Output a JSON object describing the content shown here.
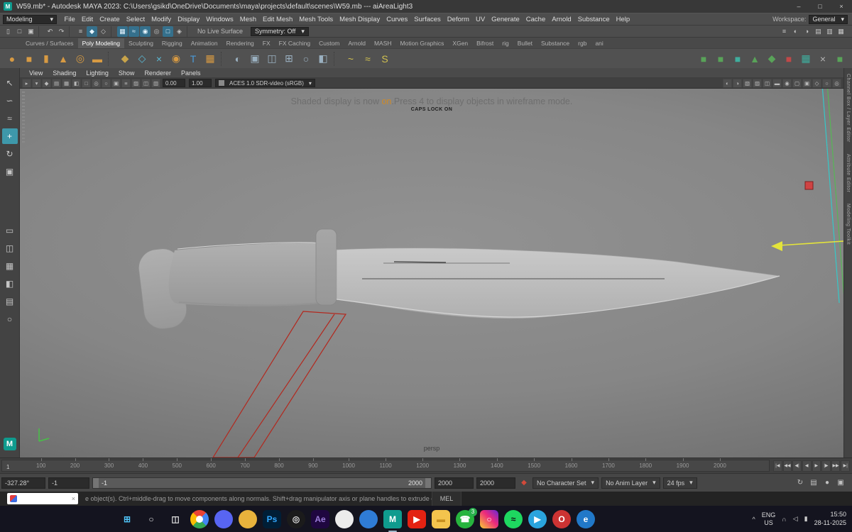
{
  "ui": {
    "chevron_down": "▾",
    "close_x": "×"
  },
  "titlebar": {
    "title": "W59.mb* - Autodesk MAYA 2023: C:\\Users\\gsikd\\OneDrive\\Documents\\maya\\projects\\default\\scenes\\W59.mb   ---   aiAreaLight3",
    "app_glyph": "M",
    "minimize": "–",
    "maximize": "□",
    "close": "×"
  },
  "menubar": {
    "mode": "Modeling",
    "items": [
      "File",
      "Edit",
      "Create",
      "Select",
      "Modify",
      "Display",
      "Windows",
      "Mesh",
      "Edit Mesh",
      "Mesh Tools",
      "Mesh Display",
      "Curves",
      "Surfaces",
      "Deform",
      "UV",
      "Generate",
      "Cache",
      "Arnold",
      "Substance",
      "Help"
    ],
    "workspace_label": "Workspace:",
    "workspace_value": "General"
  },
  "statusline": {
    "icons_left": [
      {
        "n": "new-scene-icon",
        "g": "▯"
      },
      {
        "n": "open-scene-icon",
        "g": "□"
      },
      {
        "n": "save-scene-icon",
        "g": "▣"
      },
      {
        "n": "separator",
        "cls": "sep"
      },
      {
        "n": "undo-icon",
        "g": "↶"
      },
      {
        "n": "redo-icon",
        "g": "↷"
      },
      {
        "n": "separator",
        "cls": "sep"
      },
      {
        "n": "select-hierarchy-icon",
        "g": "≡"
      },
      {
        "n": "select-object-icon",
        "g": "◆",
        "cls": "on"
      },
      {
        "n": "select-component-icon",
        "g": "◇"
      },
      {
        "n": "separator",
        "cls": "sep"
      },
      {
        "n": "snap-grid-icon",
        "g": "▦",
        "cls": "on"
      },
      {
        "n": "snap-curve-icon",
        "g": "≈",
        "cls": "on"
      },
      {
        "n": "snap-point-icon",
        "g": "◉",
        "cls": "on"
      },
      {
        "n": "snap-center-icon",
        "g": "◎"
      },
      {
        "n": "snap-plane-icon",
        "g": "□",
        "cls": "on"
      },
      {
        "n": "make-live-icon",
        "g": "◈"
      },
      {
        "n": "separator",
        "cls": "sep"
      }
    ],
    "live_surface": "No Live Surface",
    "symmetry": "Symmetry: Off",
    "icons_right": [
      {
        "n": "construction-history-icon",
        "g": "≡"
      },
      {
        "n": "render-icon",
        "g": "◐"
      },
      {
        "n": "ipr-render-icon",
        "g": "◑"
      },
      {
        "n": "render-settings-icon",
        "g": "▤"
      },
      {
        "n": "display-layers-icon",
        "g": "▥"
      },
      {
        "n": "grid-toggle-icon",
        "g": "▦"
      }
    ]
  },
  "shelf": {
    "tabs": [
      {
        "label": "Curves / Surfaces"
      },
      {
        "label": "Poly Modeling",
        "cls": "active"
      },
      {
        "label": "Sculpting"
      },
      {
        "label": "Rigging"
      },
      {
        "label": "Animation"
      },
      {
        "label": "Rendering"
      },
      {
        "label": "FX"
      },
      {
        "label": "FX Caching"
      },
      {
        "label": "Custom"
      },
      {
        "label": "Arnold"
      },
      {
        "label": "MASH"
      },
      {
        "label": "Motion Graphics"
      },
      {
        "label": "XGen"
      },
      {
        "label": "Bifrost"
      },
      {
        "label": "rig"
      },
      {
        "label": "Bullet"
      },
      {
        "label": "Substance"
      },
      {
        "label": "rgb"
      },
      {
        "label": "ani"
      }
    ],
    "icons": [
      {
        "n": "poly-sphere-icon",
        "g": "●",
        "c": "#d79a43"
      },
      {
        "n": "poly-cube-icon",
        "g": "■",
        "c": "#d79a43"
      },
      {
        "n": "poly-cylinder-icon",
        "g": "▮",
        "c": "#d79a43"
      },
      {
        "n": "poly-cone-icon",
        "g": "▲",
        "c": "#d79a43"
      },
      {
        "n": "poly-torus-icon",
        "g": "◎",
        "c": "#d79a43"
      },
      {
        "n": "poly-plane-icon",
        "g": "▬",
        "c": "#d79a43"
      },
      {
        "n": "separator",
        "cls": "shsep"
      },
      {
        "n": "sculpt-tool-icon",
        "g": "◆",
        "c": "#c8a44a"
      },
      {
        "n": "quad-draw-icon",
        "g": "◇",
        "c": "#5bb8d4"
      },
      {
        "n": "multi-cut-icon",
        "g": "×",
        "c": "#5bb8d4"
      },
      {
        "n": "target-weld-icon",
        "g": "◉",
        "c": "#d79a43"
      },
      {
        "n": "type-tool-icon",
        "g": "T",
        "c": "#4a9ad9"
      },
      {
        "n": "svg-tool-icon",
        "g": "▦",
        "c": "#d79a43"
      },
      {
        "n": "separator",
        "cls": "shsep"
      },
      {
        "n": "boolean-icon",
        "g": "◐",
        "c": "#9ab0c0"
      },
      {
        "n": "bevel-icon",
        "g": "▣",
        "c": "#9ab0c0"
      },
      {
        "n": "bridge-icon",
        "g": "◫",
        "c": "#9ab0c0"
      },
      {
        "n": "extrude-icon",
        "g": "⊞",
        "c": "#9ab0c0"
      },
      {
        "n": "smooth-icon",
        "g": "○",
        "c": "#9ab0c0"
      },
      {
        "n": "mirror-icon",
        "g": "◧",
        "c": "#9ab0c0"
      },
      {
        "n": "separator",
        "cls": "shsep"
      },
      {
        "n": "cv-curve-icon",
        "g": "~",
        "c": "#d0c050"
      },
      {
        "n": "ep-curve-icon",
        "g": "≈",
        "c": "#d0c050"
      },
      {
        "n": "arc-tool-icon",
        "g": "S",
        "c": "#d0c050"
      },
      {
        "n": "spacer",
        "cls": "shspacer"
      },
      {
        "n": "custom-cube-green-icon",
        "g": "■",
        "c": "#59a359"
      },
      {
        "n": "custom-cube-green2-icon",
        "g": "■",
        "c": "#59a359"
      },
      {
        "n": "custom-cube-teal-icon",
        "g": "■",
        "c": "#3fae9e"
      },
      {
        "n": "custom-cone-green-icon",
        "g": "▲",
        "c": "#59a359"
      },
      {
        "n": "custom-diamond-green-icon",
        "g": "◆",
        "c": "#59a359"
      },
      {
        "n": "custom-cube-red-icon",
        "g": "■",
        "c": "#c04848"
      },
      {
        "n": "custom-grid-teal-icon",
        "g": "▦",
        "c": "#3fae9e"
      },
      {
        "n": "custom-delete-icon",
        "g": "×",
        "c": "#b5b5b5"
      },
      {
        "n": "custom-cube-green3-icon",
        "g": "■",
        "c": "#59a359"
      }
    ]
  },
  "toolbox": {
    "tools": [
      {
        "n": "select-tool",
        "g": "↖"
      },
      {
        "n": "lasso-tool",
        "g": "∽"
      },
      {
        "n": "paint-select-tool",
        "g": "≈"
      },
      {
        "n": "move-tool",
        "g": "+",
        "cls": "sel"
      },
      {
        "n": "rotate-tool",
        "g": "↻"
      },
      {
        "n": "scale-tool",
        "g": "▣"
      }
    ],
    "layouts": [
      {
        "n": "single-pane-layout-icon",
        "g": "▭"
      },
      {
        "n": "two-pane-layout-icon",
        "g": "◫"
      },
      {
        "n": "four-pane-layout-icon",
        "g": "▦"
      },
      {
        "n": "outliner-layout-icon",
        "g": "◧"
      },
      {
        "n": "hypergraph-layout-icon",
        "g": "▤"
      },
      {
        "n": "zoom-tool-icon",
        "g": "○"
      }
    ],
    "m_label": "M"
  },
  "panel": {
    "menus": [
      "View",
      "Shading",
      "Lighting",
      "Show",
      "Renderer",
      "Panels"
    ],
    "icons_left": [
      {
        "n": "select-camera-icon",
        "g": "▸"
      },
      {
        "n": "lock-camera-icon",
        "g": "▾"
      },
      {
        "n": "camera-attributes-icon",
        "g": "◆"
      },
      {
        "n": "bookmarks-icon",
        "g": "▤"
      },
      {
        "n": "image-plane-icon",
        "g": "▦"
      },
      {
        "n": "2d-pan-zoom-icon",
        "g": "◧"
      },
      {
        "n": "grease-pencil-icon",
        "g": "□"
      },
      {
        "n": "grid-icon",
        "g": "◎"
      },
      {
        "n": "film-gate-icon",
        "g": "○"
      },
      {
        "n": "resolution-gate-icon",
        "g": "▣"
      },
      {
        "n": "gate-mask-icon",
        "g": "≡"
      },
      {
        "n": "field-chart-icon",
        "g": "▨"
      },
      {
        "n": "safe-action-icon",
        "g": "◫"
      },
      {
        "n": "safe-title-icon",
        "g": "▥"
      }
    ],
    "exposure": "0.00",
    "gamma": "1.00",
    "colorspace": "ACES 1.0 SDR-video (sRGB)",
    "icons_right": [
      {
        "n": "lighting-icon",
        "g": "◐"
      },
      {
        "n": "shadows-icon",
        "g": "◑"
      },
      {
        "n": "ambient-occlusion-icon",
        "g": "▧"
      },
      {
        "n": "anti-aliasing-icon",
        "g": "▨"
      },
      {
        "n": "xray-icon",
        "g": "◫"
      },
      {
        "n": "wireframe-on-shaded-icon",
        "g": "▬"
      },
      {
        "n": "textured-icon",
        "g": "◉"
      },
      {
        "n": "use-default-material-icon",
        "g": "▢"
      },
      {
        "n": "isolate-select-icon",
        "g": "▣"
      },
      {
        "n": "plugin-shapes-icon",
        "g": "◇"
      },
      {
        "n": "exposure-icon",
        "g": "○"
      },
      {
        "n": "gamma-icon",
        "g": "◎"
      }
    ]
  },
  "viewport": {
    "message_pre": "Shaded display is now ",
    "message_highlight": "on",
    "message_post": ".Press 4 to display objects in wireframe mode.",
    "caps_lock": "CAPS LOCK ON",
    "camera_label": "persp",
    "colors": {
      "knife_light": "#c9c9c9",
      "knife_mid": "#b0b0b0",
      "knife_dark": "#989898",
      "guard": "#a6a6a6",
      "wireframe": "#b3281e",
      "manip_yellow": "#e4e43a",
      "manip_cyan": "#35c8c8",
      "manip_green": "#56b656",
      "light_red": "#cf4343",
      "axis_green": "#46c246"
    }
  },
  "sidebar_right": {
    "tabs": [
      "Channel Box / Layer Editor",
      "Attribute Editor",
      "Modeling Toolkit"
    ]
  },
  "timeline": {
    "ticks": [
      "100",
      "200",
      "300",
      "400",
      "500",
      "600",
      "700",
      "800",
      "900",
      "1000",
      "1100",
      "1200",
      "1300",
      "1400",
      "1500",
      "1600",
      "1700",
      "1800",
      "1900",
      "2000"
    ],
    "current": "1",
    "controls": [
      {
        "n": "go-to-start-button",
        "g": "|◀"
      },
      {
        "n": "step-back-frame-button",
        "g": "◀◀"
      },
      {
        "n": "step-back-key-button",
        "g": "◀|"
      },
      {
        "n": "play-backwards-button",
        "g": "◀"
      },
      {
        "n": "play-forwards-button",
        "g": "▶"
      },
      {
        "n": "step-forward-key-button",
        "g": "|▶"
      },
      {
        "n": "step-forward-frame-button",
        "g": "▶▶"
      },
      {
        "n": "go-to-end-button",
        "g": "▶|"
      }
    ]
  },
  "range": {
    "value_readout": "-327.28°",
    "start": "-1",
    "range_start": "-1",
    "range_end": "2000",
    "end": "2000",
    "end2": "2000",
    "set_key_glyph": "◆",
    "character_set": "No Character Set",
    "anim_layer": "No Anim Layer",
    "fps": "24 fps",
    "icons": [
      {
        "n": "loop-icon",
        "g": "↻"
      },
      {
        "n": "anim-settings-icon",
        "g": "▤"
      },
      {
        "n": "auto-key-icon",
        "g": "●",
        "cls": "red"
      },
      {
        "n": "anim-prefs-icon",
        "g": "▣"
      }
    ]
  },
  "commandline": {
    "input_value": "",
    "mel_label": "MEL",
    "help_text": "e object(s). Ctrl+middle-drag to move components along normals. Shift+drag manipulator axis or plane handles to extrude components or clone objects. Ctrl+Shift+drag to con"
  },
  "taskbar": {
    "icons": [
      {
        "n": "start-button",
        "g": "⊞",
        "fg": "#4fc3f7"
      },
      {
        "n": "taskbar-search-icon",
        "g": "○",
        "fg": "#e0e0e0"
      },
      {
        "n": "task-view-icon",
        "g": "◫",
        "fg": "#e0e0e0"
      },
      {
        "n": "chrome-icon",
        "g": "",
        "cls": "chrome round"
      },
      {
        "n": "discord-icon",
        "g": "",
        "bg": "#5865f2",
        "cls": "round"
      },
      {
        "n": "honey-icon",
        "g": "",
        "bg": "#e8b23c",
        "cls": "round"
      },
      {
        "n": "photoshop-icon",
        "g": "Ps",
        "bg": "#001e36",
        "fg": "#31a8ff",
        "cls": "sq"
      },
      {
        "n": "obs-icon",
        "g": "◎",
        "bg": "#1b1b1b",
        "fg": "#dddddd",
        "cls": "round"
      },
      {
        "n": "after-effects-icon",
        "g": "Ae",
        "bg": "#1f0740",
        "fg": "#9a7cd8",
        "cls": "sq"
      },
      {
        "n": "chatgpt-icon",
        "g": "",
        "bg": "#ececec",
        "cls": "round"
      },
      {
        "n": "vscode-icon",
        "g": "",
        "bg": "#2f7cd6",
        "cls": "round"
      },
      {
        "n": "maya-icon",
        "g": "M",
        "bg": "#0f9b8e",
        "fg": "#ffffff",
        "cls": "sq active"
      },
      {
        "n": "youtube-icon",
        "g": "▶",
        "bg": "#e32212",
        "fg": "#ffffff",
        "cls": "sq"
      },
      {
        "n": "file-explorer-icon",
        "g": "▬",
        "bg": "#f3c44d",
        "fg": "#c8901f",
        "cls": "sq"
      },
      {
        "n": "whatsapp-icon",
        "g": "☎",
        "bg": "#27b43e",
        "fg": "#ffffff",
        "cls": "round",
        "badge": "3"
      },
      {
        "n": "instagram-icon",
        "g": "○",
        "fg": "#ffffff",
        "cls": "insta sq"
      },
      {
        "n": "spotify-icon",
        "g": "≈",
        "bg": "#1ed760",
        "fg": "#111111",
        "cls": "round"
      },
      {
        "n": "telegram-icon",
        "g": "▶",
        "bg": "#2aa4dd",
        "fg": "#ffffff",
        "cls": "round"
      },
      {
        "n": "opera-icon",
        "g": "O",
        "bg": "#cc3333",
        "fg": "#ffffff",
        "cls": "round"
      },
      {
        "n": "edge-icon",
        "g": "e",
        "bg": "#2178c8",
        "fg": "#ffffff",
        "cls": "round"
      }
    ],
    "tray": {
      "expand_glyph": "^",
      "lang_line1": "ENG",
      "lang_line2": "US",
      "wifi_glyph": "∩",
      "volume_glyph": "◁",
      "battery_glyph": "▮",
      "time": "15:50",
      "date": "28-11-2025"
    }
  }
}
